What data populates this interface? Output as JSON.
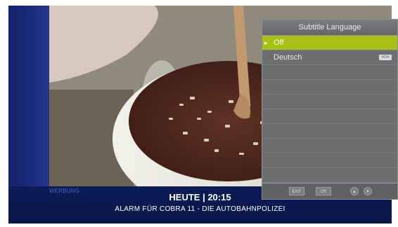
{
  "subtitle_menu": {
    "title": "Subtitle Language",
    "options": [
      {
        "label": "Off",
        "selected": true,
        "marker": "▸"
      },
      {
        "label": "Deutsch",
        "selected": false,
        "badge": "HOH"
      }
    ],
    "buttons": {
      "exit": "EXIT",
      "ok": "OK",
      "up": "▲",
      "down": "▼"
    },
    "colors": {
      "panel": "#6c6e70",
      "selected_row": "#a9c018"
    }
  },
  "ticker": {
    "ad_label": "WERBUNG",
    "time": "HEUTE | 20:15",
    "show": "ALARM FÜR COBRA 11 - DIE AUTOBAHNPOLIZEI",
    "color": "#0c1c57"
  }
}
